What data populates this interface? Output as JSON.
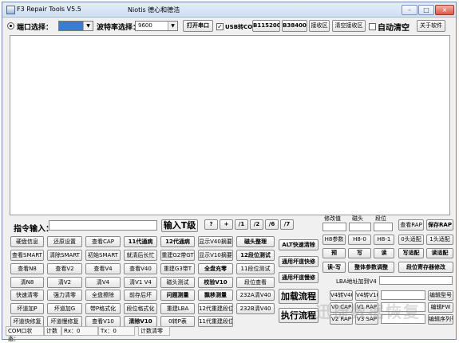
{
  "window": {
    "title": "F3 Repair Tools V5.5",
    "author": "Niotis  德心和德浩",
    "minimize": "–",
    "maximize": "□",
    "close": "×"
  },
  "top": {
    "port_label": "端口选择：",
    "baud_label": "波特率选择：",
    "baud_value": "9600",
    "open_port": "打开串口",
    "usb_checkbox_label": "USB转COM",
    "usb_checked": true,
    "baud_115200": "B115200",
    "baud_38400": "B38400",
    "receive_area": "接收区",
    "clear_receive": "清空接收区",
    "auto_clear": "自动清空",
    "about": "关于软件"
  },
  "command": {
    "input_label": "指令输入：",
    "input_value": "",
    "enter_t": "输入T级",
    "quick": [
      "?",
      "+",
      "/1",
      "/2",
      "/6",
      "/7"
    ]
  },
  "grid": [
    [
      "硬盘信息",
      "还原设置",
      "查看CAP",
      "11代通病",
      "12代通病",
      "显示V40摘要",
      "磁头整理"
    ],
    [
      "查看SMART",
      "清除SMART",
      "初始SMART",
      "就清后长忙",
      "重建G2带GT",
      "显示V10摘要",
      "12段位测试"
    ],
    [
      "查看N8",
      "查看V2",
      "查看V4",
      "查看V40",
      "重建G3带T",
      "全盘充零",
      "11段位测试"
    ],
    [
      "清N8",
      "清V2",
      "清V4",
      "清V1 V4",
      "磁头测试",
      "校验V10",
      "段位查看"
    ],
    [
      "快速清零",
      "强力清零",
      "全盘擦除",
      "前存后坏",
      "问题测量",
      "飘移测量",
      "232A清V40"
    ],
    [
      "坏道加P",
      "坏道加G",
      "带P格式化",
      "段位格式化",
      "重建LBA",
      "12代重建段位",
      "232B清V40"
    ],
    [
      "坏道快修复",
      "坏道慢修复",
      "查看V10",
      "清除V10",
      "0转P表",
      "11代重建段位",
      ""
    ]
  ],
  "right": {
    "header_labels": [
      "修改值",
      "磁头",
      "段位"
    ],
    "alt_clear": "ALT快速清除",
    "universal_fast": "通用坏道快修",
    "universal_slow": "通用坏道慢修",
    "load_process": "加载流程",
    "exec_process": "执行流程",
    "param_buttons": [
      "H8参数",
      "H8-0",
      "H8-1"
    ],
    "pre": "预",
    "write": "写",
    "read": "读",
    "read_write": "读-写",
    "all_params": "整体参数调整",
    "lba_label": "LBA地址加到V4",
    "v4_v40": "V4转V40",
    "v4_v10": "V4转V10",
    "v_cap": "V0 CAP",
    "v1_rap": "V1 RAP",
    "v2_rap": "V2 RAP",
    "v3_sap": "V3 SAP",
    "view_rap": "查看RAP",
    "save_rap": "保存RAP",
    "zero_head": "0头适配",
    "one_head": "1头适配",
    "write_adapt": "写适配",
    "read_adapt": "读适配",
    "segment_reg": "段位寄存器修改",
    "edit_model": "编辑型号",
    "edit_fw": "编辑FW",
    "edit_sn": "编辑序列号"
  },
  "status": {
    "com_state": "COM口状态：",
    "count": "计数",
    "rx": "Rx：0",
    "tx": "Tx：0",
    "clear_count": "计数清零"
  }
}
